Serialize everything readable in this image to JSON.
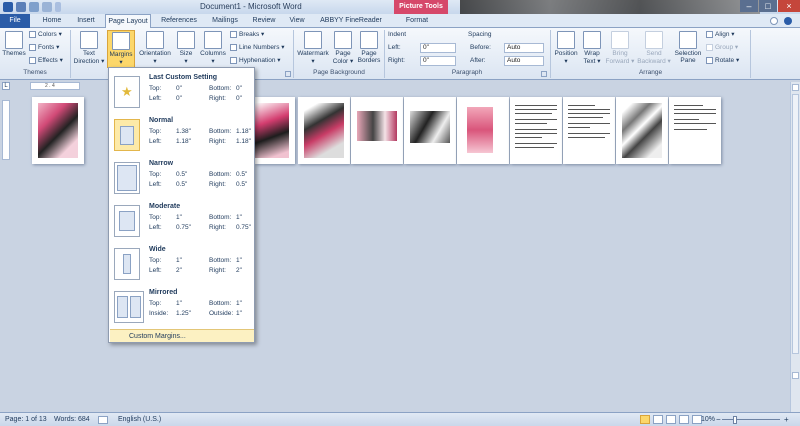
{
  "title_bar": {
    "document_title": "Document1 - Microsoft Word",
    "context_tab": "Picture Tools"
  },
  "tabs": [
    "File",
    "Home",
    "Insert",
    "Page Layout",
    "References",
    "Mailings",
    "Review",
    "View",
    "ABBYY FineReader 11",
    "Format"
  ],
  "active_tab": "Page Layout",
  "ribbon": {
    "themes_group": {
      "label": "Themes",
      "themes_button": "Themes",
      "colors": "Colors",
      "fonts": "Fonts",
      "effects": "Effects"
    },
    "page_setup": {
      "text_direction_line1": "Text",
      "text_direction_line2": "Direction",
      "margins": "Margins",
      "orientation": "Orientation",
      "size": "Size",
      "columns": "Columns",
      "breaks": "Breaks",
      "line_numbers": "Line Numbers",
      "hyphenation": "Hyphenation"
    },
    "page_background": {
      "label": "Page Background",
      "watermark": "Watermark",
      "page_color_line1": "Page",
      "page_color_line2": "Color",
      "page_borders_line1": "Page",
      "page_borders_line2": "Borders"
    },
    "paragraph": {
      "label": "Paragraph",
      "indent_heading": "Indent",
      "left_label": "Left:",
      "left_value": "0\"",
      "right_label": "Right:",
      "right_value": "0\"",
      "spacing_heading": "Spacing",
      "before_label": "Before:",
      "before_value": "Auto",
      "after_label": "After:",
      "after_value": "Auto"
    },
    "arrange": {
      "label": "Arrange",
      "position": "Position",
      "wrap_text_line1": "Wrap",
      "wrap_text_line2": "Text",
      "bring_forward_line1": "Bring",
      "bring_forward_line2": "Forward",
      "send_backward_line1": "Send",
      "send_backward_line2": "Backward",
      "selection_pane_line1": "Selection",
      "selection_pane_line2": "Pane",
      "align": "Align",
      "group": "Group",
      "rotate": "Rotate"
    }
  },
  "ruler_numbers": "2 . 4",
  "margins_menu": {
    "options": [
      {
        "name": "Last Custom Setting",
        "k1": "Top:",
        "v1": "0\"",
        "k2": "Bottom:",
        "v2": "0\"",
        "k3": "Left:",
        "v3": "0\"",
        "k4": "Right:",
        "v4": "0\""
      },
      {
        "name": "Normal",
        "k1": "Top:",
        "v1": "1.38\"",
        "k2": "Bottom:",
        "v2": "1.18\"",
        "k3": "Left:",
        "v3": "1.18\"",
        "k4": "Right:",
        "v4": "1.18\""
      },
      {
        "name": "Narrow",
        "k1": "Top:",
        "v1": "0.5\"",
        "k2": "Bottom:",
        "v2": "0.5\"",
        "k3": "Left:",
        "v3": "0.5\"",
        "k4": "Right:",
        "v4": "0.5\""
      },
      {
        "name": "Moderate",
        "k1": "Top:",
        "v1": "1\"",
        "k2": "Bottom:",
        "v2": "1\"",
        "k3": "Left:",
        "v3": "0.75\"",
        "k4": "Right:",
        "v4": "0.75\""
      },
      {
        "name": "Wide",
        "k1": "Top:",
        "v1": "1\"",
        "k2": "Bottom:",
        "v2": "1\"",
        "k3": "Left:",
        "v3": "2\"",
        "k4": "Right:",
        "v4": "2\""
      },
      {
        "name": "Mirrored",
        "k1": "Top:",
        "v1": "1\"",
        "k2": "Bottom:",
        "v2": "1\"",
        "k3": "Inside:",
        "v3": "1.25\"",
        "k4": "Outside:",
        "v4": "1\""
      }
    ],
    "custom_margins": "Custom Margins..."
  },
  "status_bar": {
    "page": "Page: 1 of 13",
    "words": "Words: 684",
    "language": "English (U.S.)",
    "zoom": "10%"
  },
  "colors": {
    "accent": "#2a5ca8",
    "highlight": "#fcd76a",
    "context_tab": "#d6486a"
  }
}
